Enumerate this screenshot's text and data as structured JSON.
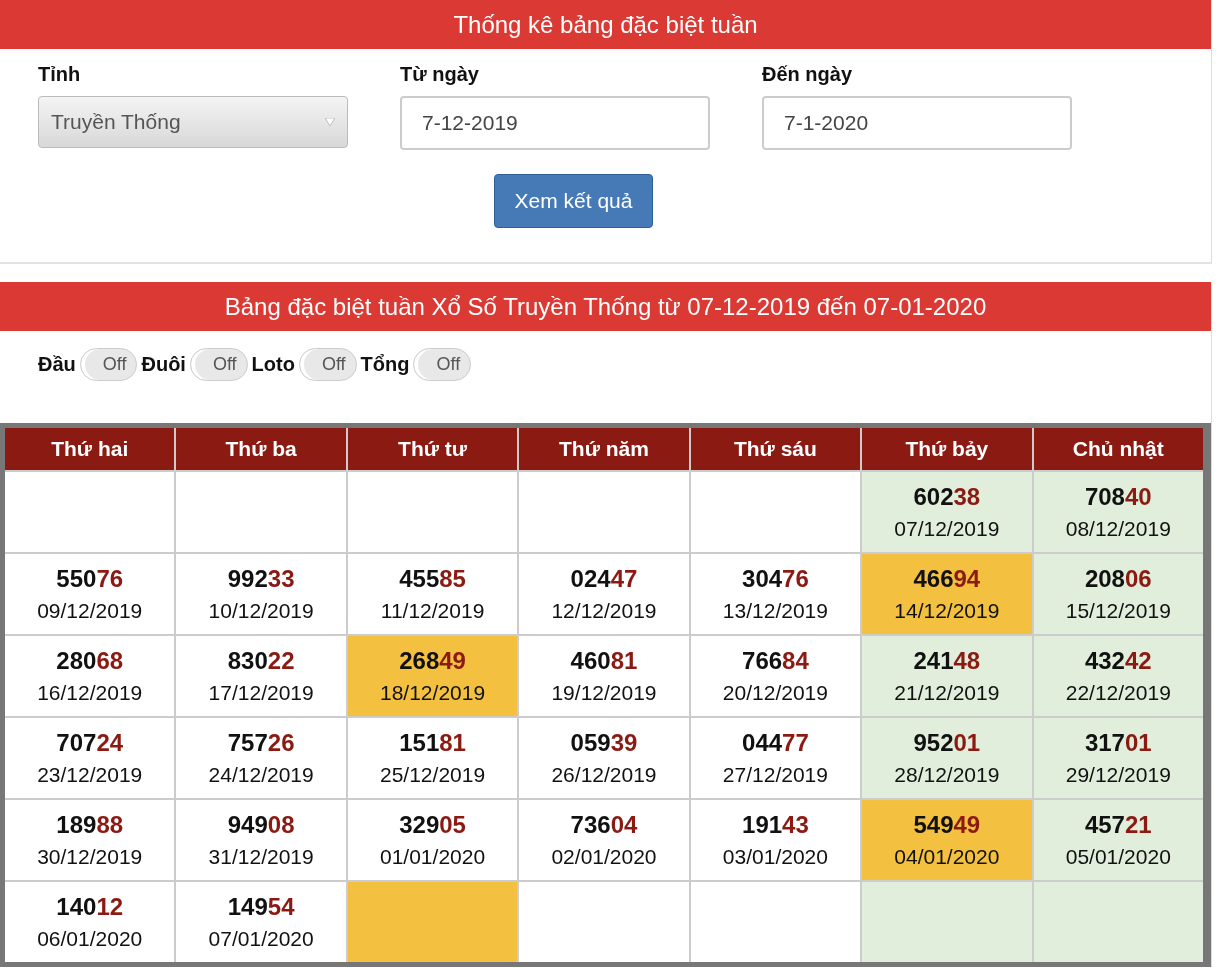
{
  "form": {
    "title": "Thống kê bảng đặc biệt tuần",
    "fields": [
      {
        "kind": "select",
        "label": "Tỉnh",
        "value": "Truyền Thống"
      },
      {
        "kind": "input",
        "label": "Từ ngày",
        "value": "7-12-2019"
      },
      {
        "kind": "input",
        "label": "Đến ngày",
        "value": "7-1-2020"
      }
    ],
    "submit": "Xem kết quả"
  },
  "results": {
    "title": "Bảng đặc biệt tuần Xổ Số Truyền Thống từ 07-12-2019 đến 07-01-2020",
    "toggles": [
      {
        "label": "Đầu",
        "state": "Off",
        "on": false
      },
      {
        "label": "Đuôi",
        "state": "Off",
        "on": false
      },
      {
        "label": "Loto",
        "state": "Off",
        "on": false
      },
      {
        "label": "Tổng",
        "state": "Off",
        "on": false
      }
    ],
    "columns": [
      {
        "label": "Thứ hai",
        "weekend": false
      },
      {
        "label": "Thứ ba",
        "weekend": false
      },
      {
        "label": "Thứ tư",
        "weekend": false
      },
      {
        "label": "Thứ năm",
        "weekend": false
      },
      {
        "label": "Thứ sáu",
        "weekend": false
      },
      {
        "label": "Thứ bảy",
        "weekend": true
      },
      {
        "label": "Chủ nhật",
        "weekend": true
      }
    ],
    "rows": [
      [
        {
          "highlighted": false
        },
        {
          "highlighted": false
        },
        {
          "highlighted": false
        },
        {
          "highlighted": false
        },
        {
          "highlighted": false
        },
        {
          "head": "602",
          "tail": "38",
          "date": "07/12/2019",
          "highlighted": false
        },
        {
          "head": "708",
          "tail": "40",
          "date": "08/12/2019",
          "highlighted": false
        }
      ],
      [
        {
          "head": "550",
          "tail": "76",
          "date": "09/12/2019",
          "highlighted": false
        },
        {
          "head": "992",
          "tail": "33",
          "date": "10/12/2019",
          "highlighted": false
        },
        {
          "head": "455",
          "tail": "85",
          "date": "11/12/2019",
          "highlighted": false
        },
        {
          "head": "024",
          "tail": "47",
          "date": "12/12/2019",
          "highlighted": false
        },
        {
          "head": "304",
          "tail": "76",
          "date": "13/12/2019",
          "highlighted": false
        },
        {
          "head": "466",
          "tail": "94",
          "date": "14/12/2019",
          "highlighted": true
        },
        {
          "head": "208",
          "tail": "06",
          "date": "15/12/2019",
          "highlighted": false
        }
      ],
      [
        {
          "head": "280",
          "tail": "68",
          "date": "16/12/2019",
          "highlighted": false
        },
        {
          "head": "830",
          "tail": "22",
          "date": "17/12/2019",
          "highlighted": false
        },
        {
          "head": "268",
          "tail": "49",
          "date": "18/12/2019",
          "highlighted": true
        },
        {
          "head": "460",
          "tail": "81",
          "date": "19/12/2019",
          "highlighted": false
        },
        {
          "head": "766",
          "tail": "84",
          "date": "20/12/2019",
          "highlighted": false
        },
        {
          "head": "241",
          "tail": "48",
          "date": "21/12/2019",
          "highlighted": false
        },
        {
          "head": "432",
          "tail": "42",
          "date": "22/12/2019",
          "highlighted": false
        }
      ],
      [
        {
          "head": "707",
          "tail": "24",
          "date": "23/12/2019",
          "highlighted": false
        },
        {
          "head": "757",
          "tail": "26",
          "date": "24/12/2019",
          "highlighted": false
        },
        {
          "head": "151",
          "tail": "81",
          "date": "25/12/2019",
          "highlighted": false
        },
        {
          "head": "059",
          "tail": "39",
          "date": "26/12/2019",
          "highlighted": false
        },
        {
          "head": "044",
          "tail": "77",
          "date": "27/12/2019",
          "highlighted": false
        },
        {
          "head": "952",
          "tail": "01",
          "date": "28/12/2019",
          "highlighted": false
        },
        {
          "head": "317",
          "tail": "01",
          "date": "29/12/2019",
          "highlighted": false
        }
      ],
      [
        {
          "head": "189",
          "tail": "88",
          "date": "30/12/2019",
          "highlighted": false
        },
        {
          "head": "949",
          "tail": "08",
          "date": "31/12/2019",
          "highlighted": false
        },
        {
          "head": "329",
          "tail": "05",
          "date": "01/01/2020",
          "highlighted": false
        },
        {
          "head": "736",
          "tail": "04",
          "date": "02/01/2020",
          "highlighted": false
        },
        {
          "head": "191",
          "tail": "43",
          "date": "03/01/2020",
          "highlighted": false
        },
        {
          "head": "549",
          "tail": "49",
          "date": "04/01/2020",
          "highlighted": true
        },
        {
          "head": "457",
          "tail": "21",
          "date": "05/01/2020",
          "highlighted": false
        }
      ],
      [
        {
          "head": "140",
          "tail": "12",
          "date": "06/01/2020",
          "highlighted": false
        },
        {
          "head": "149",
          "tail": "54",
          "date": "07/01/2020",
          "highlighted": false
        },
        {
          "highlighted": true
        },
        {
          "highlighted": false
        },
        {
          "highlighted": false
        },
        {
          "highlighted": false
        },
        {
          "highlighted": false
        }
      ]
    ]
  }
}
